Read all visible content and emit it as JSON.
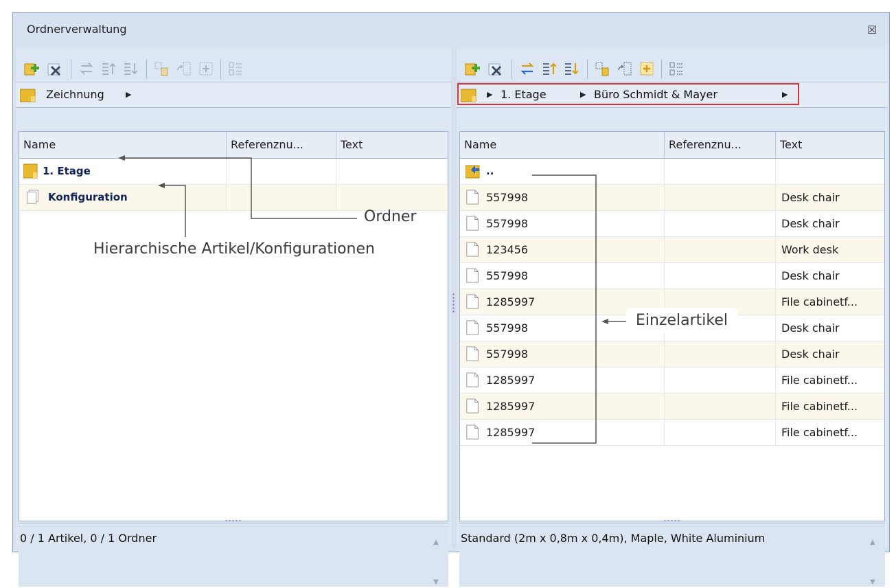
{
  "window": {
    "title": "Ordnerverwaltung",
    "close_symbol": "☒"
  },
  "left": {
    "breadcrumb": [
      "Zeichnung"
    ],
    "columns": [
      "Name",
      "Referenznu...",
      "Text"
    ],
    "rows": [
      {
        "name": "1. Etage",
        "ref": "",
        "text": "",
        "icon": "folder-icon"
      },
      {
        "name": "Konfiguration",
        "ref": "",
        "text": "",
        "icon": "configuration-document-icon"
      }
    ],
    "status": "0 / 1 Artikel, 0 / 1 Ordner"
  },
  "right": {
    "breadcrumb": [
      "1. Etage",
      "Büro Schmidt & Mayer"
    ],
    "columns": [
      "Name",
      "Referenznu...",
      "Text"
    ],
    "rows": [
      {
        "name": "..",
        "ref": "",
        "text": "",
        "icon": "parent-folder-icon"
      },
      {
        "name": "557998",
        "ref": "",
        "text": "Desk chair",
        "icon": "document-icon"
      },
      {
        "name": "557998",
        "ref": "",
        "text": "Desk chair",
        "icon": "document-icon"
      },
      {
        "name": "123456",
        "ref": "",
        "text": "Work desk",
        "icon": "document-icon"
      },
      {
        "name": "557998",
        "ref": "",
        "text": "Desk chair",
        "icon": "document-icon"
      },
      {
        "name": "1285997",
        "ref": "",
        "text": "File cabinetf...",
        "icon": "document-icon"
      },
      {
        "name": "557998",
        "ref": "",
        "text": "Desk chair",
        "icon": "document-icon"
      },
      {
        "name": "557998",
        "ref": "",
        "text": "Desk chair",
        "icon": "document-icon"
      },
      {
        "name": "1285997",
        "ref": "",
        "text": "File cabinetf...",
        "icon": "document-icon"
      },
      {
        "name": "1285997",
        "ref": "",
        "text": "File cabinetf...",
        "icon": "document-icon"
      },
      {
        "name": "1285997",
        "ref": "",
        "text": "File cabinetf...",
        "icon": "document-icon"
      }
    ],
    "status": "Standard (2m x 0,8m x 0,4m), Maple, White Aluminium"
  },
  "annotations": {
    "ordner": "Ordner",
    "hierarchisch": "Hierarchische Artikel/Konfigurationen",
    "einzelartikel": "Einzelartikel"
  },
  "colors": {
    "highlight": "#e0313b",
    "folder": "#e9b92f",
    "add": "#49a52e",
    "delete": "#3b4a66"
  },
  "toolbar_icons": [
    "add-icon",
    "delete-icon",
    "swap-icon",
    "move-up-icon",
    "move-down-icon",
    "copy-icon",
    "insert-icon",
    "group-icon",
    "numbering-icon"
  ]
}
